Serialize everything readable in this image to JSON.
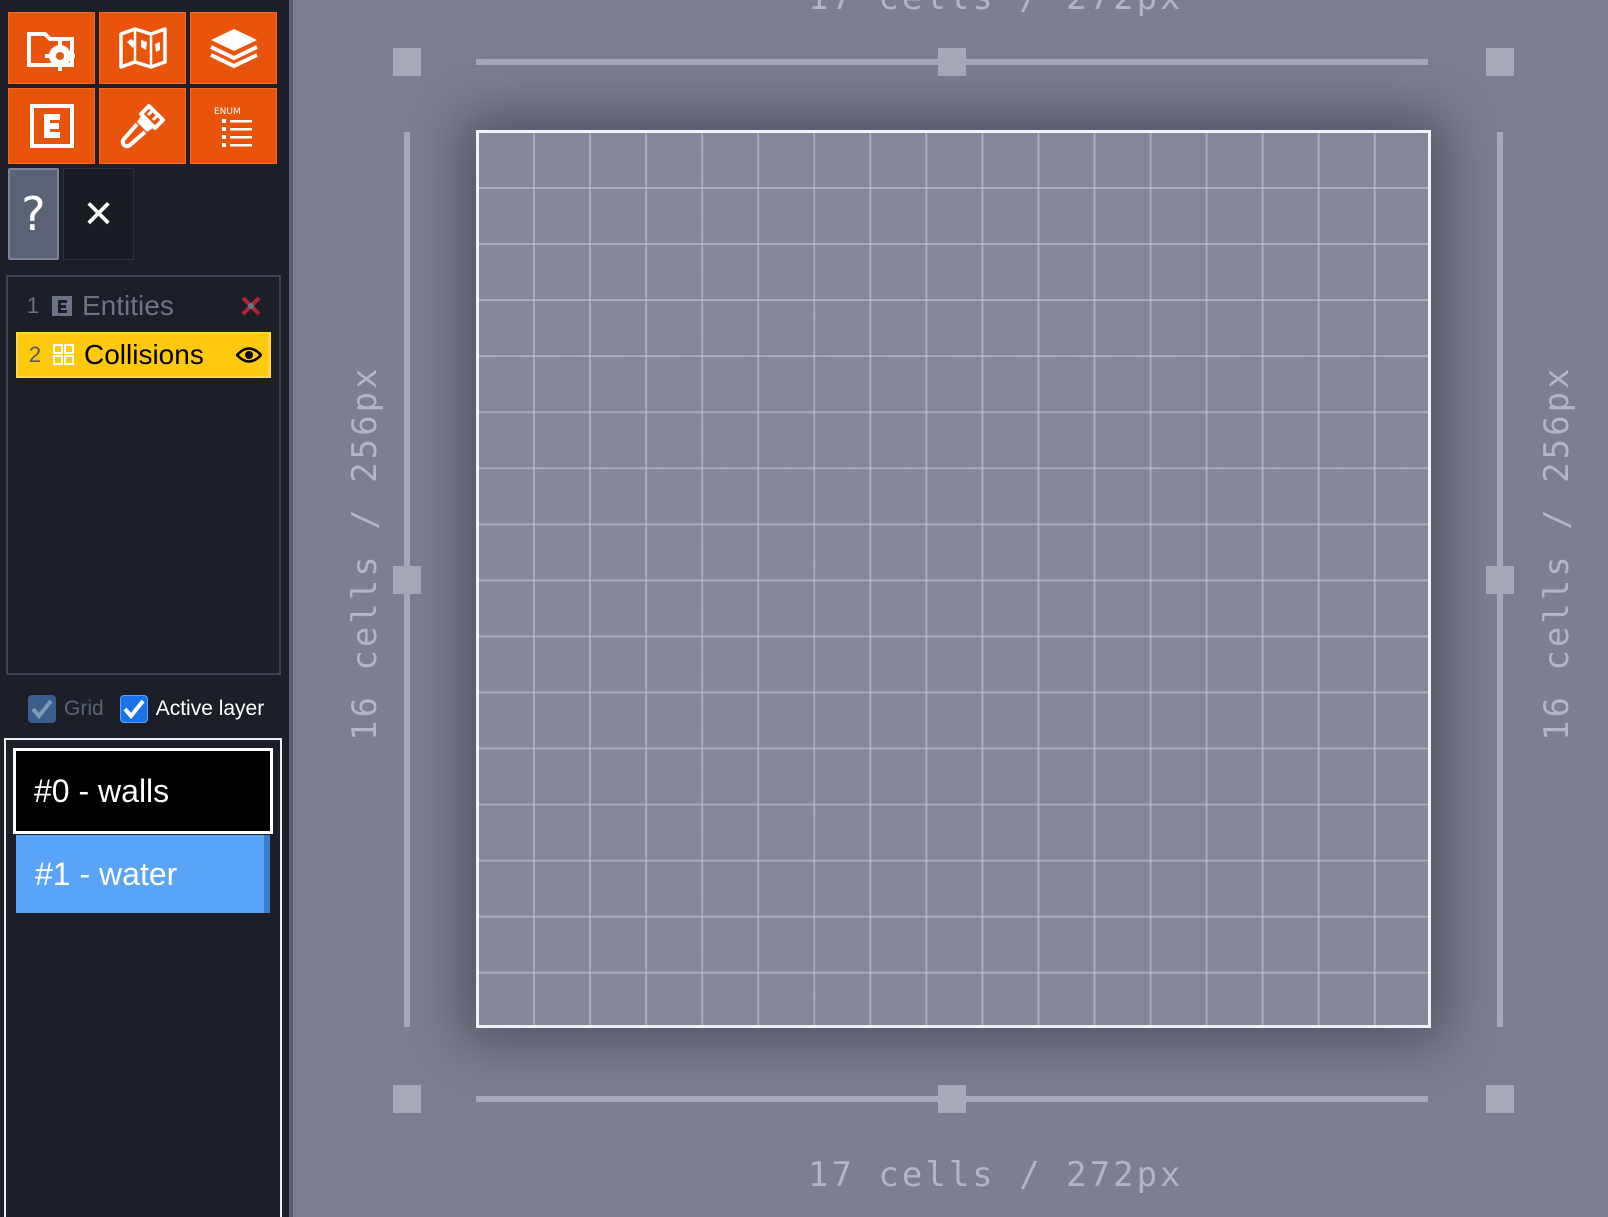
{
  "toolbar": {
    "buttons": [
      {
        "id": "project-settings",
        "icon": "folder-gear-icon"
      },
      {
        "id": "world",
        "icon": "world-map-icon"
      },
      {
        "id": "layers",
        "icon": "layers-stack-icon"
      },
      {
        "id": "entities",
        "icon": "entity-e-icon"
      },
      {
        "id": "tilesets",
        "icon": "brush-icon"
      },
      {
        "id": "enums",
        "icon": "enum-list-icon",
        "icon_text": "ENUM"
      }
    ],
    "help_label": "?",
    "close_label": "✕"
  },
  "layers": [
    {
      "index": "1",
      "name": "Entities",
      "type_icon": "entity-layer-icon",
      "state_icon": "hidden-x-icon",
      "active": false
    },
    {
      "index": "2",
      "name": "Collisions",
      "type_icon": "intgrid-layer-icon",
      "state_icon": "eye-icon",
      "active": true
    }
  ],
  "options": {
    "grid_label": "Grid",
    "grid_checked": true,
    "active_layer_label": "Active layer",
    "active_layer_checked": true
  },
  "intgrid_values": [
    {
      "label": "#0 - walls",
      "color": "#000000",
      "selected": true
    },
    {
      "label": "#1 - water",
      "color": "#5aa4f7",
      "selected": false
    }
  ],
  "level": {
    "width_label": "17 cells / 272px",
    "height_label": "16 cells / 256px",
    "cols": 17,
    "rows": 16
  },
  "colors": {
    "accent": "#e8540c",
    "active_layer": "#ffc90e",
    "canvas_bg": "#7c7e91",
    "water": "#5aa4f7"
  }
}
